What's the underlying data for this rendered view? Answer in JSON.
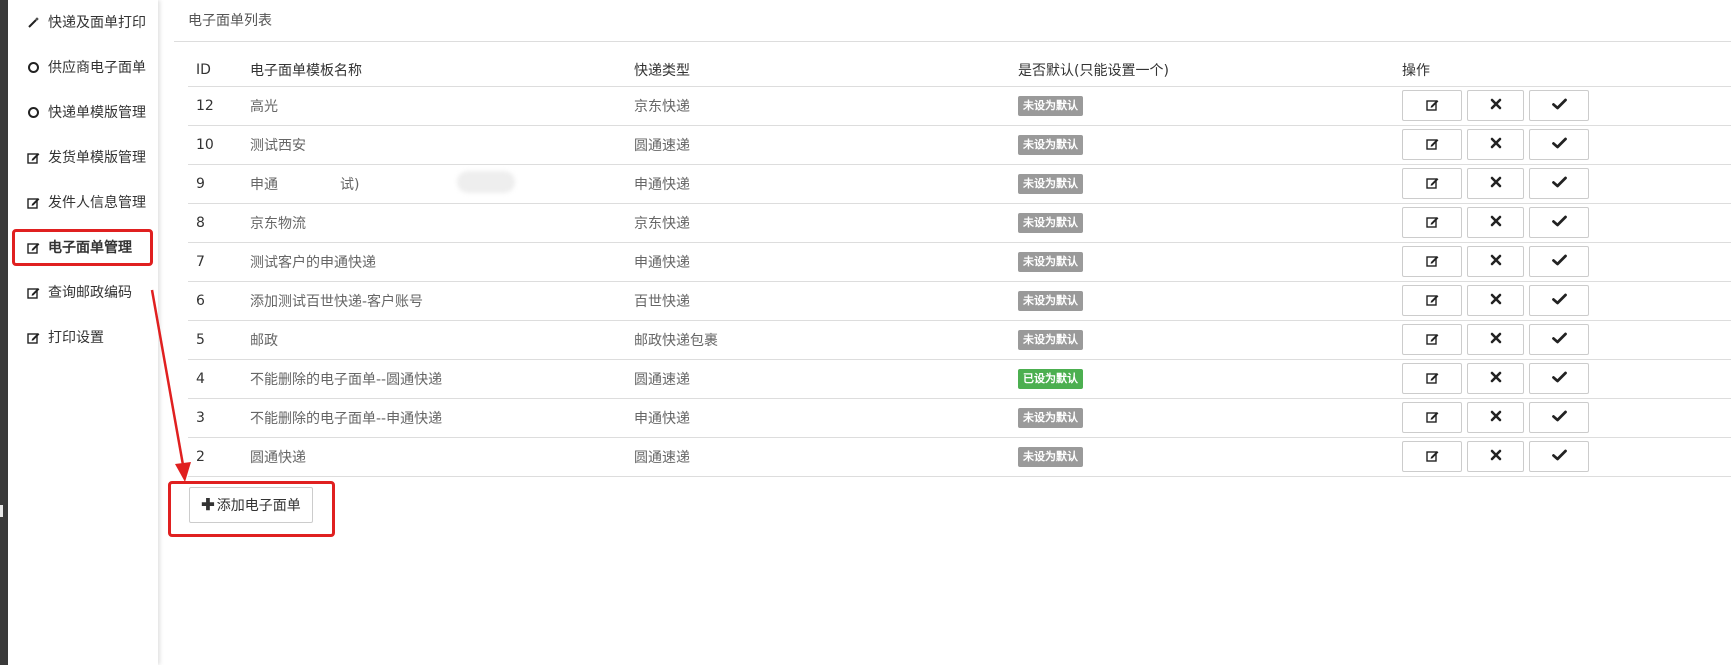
{
  "sidebar": {
    "items": [
      {
        "label": "快递及面单打印",
        "icon": "magic-wand-icon"
      },
      {
        "label": "供应商电子面单",
        "icon": "circle-icon"
      },
      {
        "label": "快递单模版管理",
        "icon": "circle-icon"
      },
      {
        "label": "发货单模版管理",
        "icon": "edit-icon"
      },
      {
        "label": "发件人信息管理",
        "icon": "edit-icon"
      },
      {
        "label": "电子面单管理",
        "icon": "edit-icon"
      },
      {
        "label": "查询邮政编码",
        "icon": "edit-icon"
      },
      {
        "label": "打印设置",
        "icon": "edit-icon"
      }
    ]
  },
  "panel": {
    "title": "电子面单列表"
  },
  "table": {
    "headers": [
      "ID",
      "电子面单模板名称",
      "快递类型",
      "是否默认(只能设置一个)",
      "操作"
    ],
    "rows": [
      {
        "id": "12",
        "name": "高光",
        "type": "京东快递",
        "status": "未设为默认",
        "is_default": false
      },
      {
        "id": "10",
        "name": "测试西安",
        "type": "圆通速递",
        "status": "未设为默认",
        "is_default": false
      },
      {
        "id": "9",
        "name": "申通",
        "name_tail": "试)",
        "type": "申通快递",
        "status": "未设为默认",
        "is_default": false
      },
      {
        "id": "8",
        "name": "京东物流",
        "type": "京东快递",
        "status": "未设为默认",
        "is_default": false
      },
      {
        "id": "7",
        "name": "测试客户的申通快递",
        "type": "申通快递",
        "status": "未设为默认",
        "is_default": false
      },
      {
        "id": "6",
        "name": "添加测试百世快递-客户账号",
        "type": "百世快递",
        "status": "未设为默认",
        "is_default": false
      },
      {
        "id": "5",
        "name": "邮政",
        "type": "邮政快递包裹",
        "status": "未设为默认",
        "is_default": false
      },
      {
        "id": "4",
        "name": "不能删除的电子面单--圆通快递",
        "type": "圆通速递",
        "status": "已设为默认",
        "is_default": true
      },
      {
        "id": "3",
        "name": "不能删除的电子面单--申通快递",
        "type": "申通快递",
        "status": "未设为默认",
        "is_default": false
      },
      {
        "id": "2",
        "name": "圆通快递",
        "type": "圆通速递",
        "status": "未设为默认",
        "is_default": false
      }
    ]
  },
  "actions": {
    "add_label": "添加电子面单",
    "add_icon": "plus-icon",
    "row_icons": [
      "edit-icon",
      "close-icon",
      "check-icon"
    ]
  },
  "colors": {
    "highlight": "#e02020",
    "badge_default": "#4caf50",
    "badge_not_default": "#9a9a9a"
  }
}
